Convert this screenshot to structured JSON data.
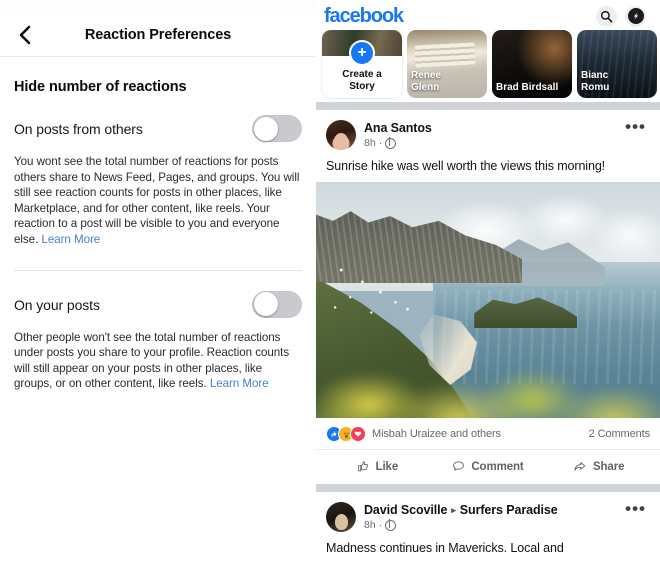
{
  "left_panel": {
    "nav": {
      "back_icon": "chevron-left-icon",
      "title": "Reaction Preferences"
    },
    "section_heading": "Hide number of reactions",
    "preferences": [
      {
        "label": "On posts from others",
        "description": "You wont see the total number of reactions for posts others share to News Feed, Pages, and groups. You will still see reaction counts for posts in other places, like Marketplace, and for other content, like reels. Your reaction to a post will be visible to you and everyone else. ",
        "link_label": "Learn More",
        "toggle_state": "off"
      },
      {
        "label": "On your posts",
        "description": "Other people won't see the total number of reactions under posts you share to your profile. Reaction counts will still appear on your posts in other places, like groups, or on other content, like reels. ",
        "link_label": "Learn More",
        "toggle_state": "off"
      }
    ]
  },
  "right_panel": {
    "topbar": {
      "logo": "facebook",
      "logo_color": "#1877f2",
      "search_icon": "search-icon",
      "messenger_icon": "messenger-icon"
    },
    "stories": [
      {
        "label": "Create a\nStory",
        "line1": "Create a",
        "line2": "Story",
        "type": "create"
      },
      {
        "line1": "Renee",
        "line2": "Glenn",
        "type": "photo"
      },
      {
        "line1": "Brad Birdsall",
        "line2": "",
        "type": "photo"
      },
      {
        "line1": "Bianc",
        "line2": "Romu",
        "type": "photo"
      }
    ],
    "posts": [
      {
        "author": "Ana Santos",
        "place": "",
        "separator": "",
        "time": "8h",
        "dot": "·",
        "audience_icon": "globe-icon",
        "menu_icon": "more-options-icon",
        "text": "Sunrise hike was well worth the views this morning!",
        "has_photo": true,
        "reactions": {
          "icons": [
            "like-reaction-icon",
            "wow-reaction-icon",
            "love-reaction-icon"
          ],
          "names": "Misbah Uraizee and others",
          "comments": "2 Comments"
        },
        "actions": [
          {
            "label": "Like",
            "icon": "thumbs-up-icon"
          },
          {
            "label": "Comment",
            "icon": "comment-bubble-icon"
          },
          {
            "label": "Share",
            "icon": "share-arrow-icon"
          }
        ]
      },
      {
        "author": "David Scoville",
        "separator": "▸",
        "place": "Surfers Paradise",
        "time": "8h",
        "dot": "·",
        "audience_icon": "globe-icon",
        "menu_icon": "more-options-icon",
        "text": "Madness continues in Mavericks. Local and",
        "has_photo": false
      }
    ]
  }
}
